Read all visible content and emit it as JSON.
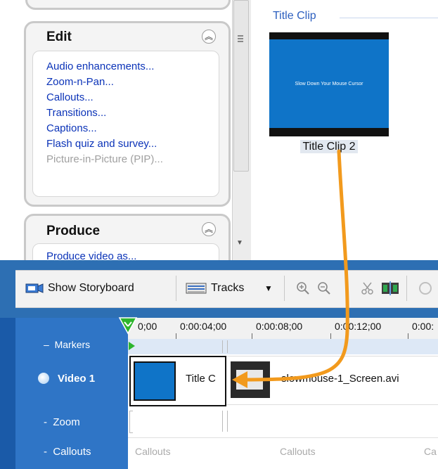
{
  "task_pane": {
    "edit": {
      "title": "Edit",
      "items": [
        {
          "label": "Audio enhancements...",
          "enabled": true
        },
        {
          "label": "Zoom-n-Pan...",
          "enabled": true
        },
        {
          "label": "Callouts...",
          "enabled": true
        },
        {
          "label": "Transitions...",
          "enabled": true
        },
        {
          "label": "Captions...",
          "enabled": true
        },
        {
          "label": "Flash quiz and survey...",
          "enabled": true
        },
        {
          "label": "Picture-in-Picture (PIP)...",
          "enabled": false
        }
      ]
    },
    "produce": {
      "title": "Produce",
      "first_item_partial": "Produce video as..."
    }
  },
  "clip_bin": {
    "section_title": "Title Clip",
    "clip": {
      "thumbnail_text": "Slow Down Your Mouse Cursor",
      "caption": "Title Clip 2"
    }
  },
  "toolbar": {
    "show_storyboard": "Show Storyboard",
    "tracks": "Tracks"
  },
  "timeline": {
    "ruler_labels": [
      "0;00",
      "0:00:04;00",
      "0:00:08;00",
      "0:00:12;00",
      "0:00:"
    ],
    "tracks": [
      {
        "label": "Markers"
      },
      {
        "label": "Video 1"
      },
      {
        "label": "Zoom"
      },
      {
        "label": "Callouts"
      }
    ],
    "video_clips": [
      {
        "label": "Title C"
      },
      {
        "label": "slowmouse-1_Screen.avi"
      }
    ],
    "callouts_placeholder": "Callouts"
  },
  "colors": {
    "accent_blue": "#2d6fb3",
    "link_blue": "#0b33b8",
    "arrow_orange": "#f29a1d",
    "playhead_green": "#2db52d"
  }
}
